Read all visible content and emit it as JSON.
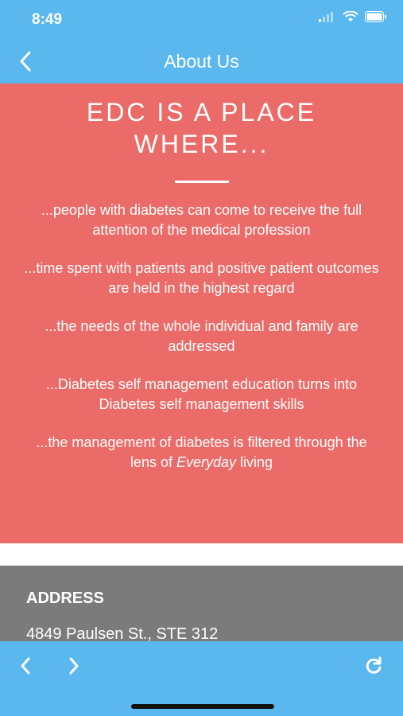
{
  "status_bar": {
    "time": "8:49"
  },
  "nav": {
    "title": "About Us"
  },
  "content": {
    "headline": "EDC IS A PLACE WHERE...",
    "paragraphs": [
      "...people with diabetes can come to receive the full attention of the medical profession",
      "...time spent with patients and positive patient outcomes are held in the highest regard",
      "...the needs of the whole individual and family are addressed",
      "...Diabetes self management education turns into Diabetes self management skills"
    ],
    "last_paragraph": {
      "before": "...the management of diabetes is filtered through the lens of ",
      "emphasis": "Everyday",
      "after": " living"
    }
  },
  "address": {
    "heading": "ADDRESS",
    "line1": "4849 Paulsen St., STE 312"
  },
  "colors": {
    "accent": "#5ab8ee",
    "content_bg": "#eb6b68",
    "address_bg": "#7b7b7b"
  }
}
